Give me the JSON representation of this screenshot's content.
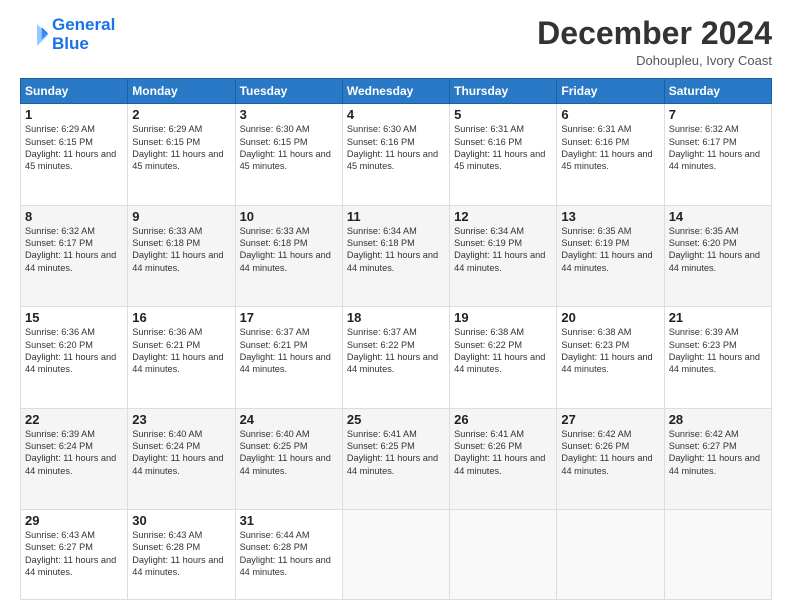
{
  "logo": {
    "line1": "General",
    "line2": "Blue"
  },
  "header": {
    "month": "December 2024",
    "location": "Dohoupleu, Ivory Coast"
  },
  "weekdays": [
    "Sunday",
    "Monday",
    "Tuesday",
    "Wednesday",
    "Thursday",
    "Friday",
    "Saturday"
  ],
  "weeks": [
    [
      {
        "day": "1",
        "rise": "6:29 AM",
        "set": "6:15 PM",
        "dh": "11 hours and 45 minutes."
      },
      {
        "day": "2",
        "rise": "6:29 AM",
        "set": "6:15 PM",
        "dh": "11 hours and 45 minutes."
      },
      {
        "day": "3",
        "rise": "6:30 AM",
        "set": "6:15 PM",
        "dh": "11 hours and 45 minutes."
      },
      {
        "day": "4",
        "rise": "6:30 AM",
        "set": "6:16 PM",
        "dh": "11 hours and 45 minutes."
      },
      {
        "day": "5",
        "rise": "6:31 AM",
        "set": "6:16 PM",
        "dh": "11 hours and 45 minutes."
      },
      {
        "day": "6",
        "rise": "6:31 AM",
        "set": "6:16 PM",
        "dh": "11 hours and 45 minutes."
      },
      {
        "day": "7",
        "rise": "6:32 AM",
        "set": "6:17 PM",
        "dh": "11 hours and 44 minutes."
      }
    ],
    [
      {
        "day": "8",
        "rise": "6:32 AM",
        "set": "6:17 PM",
        "dh": "11 hours and 44 minutes."
      },
      {
        "day": "9",
        "rise": "6:33 AM",
        "set": "6:18 PM",
        "dh": "11 hours and 44 minutes."
      },
      {
        "day": "10",
        "rise": "6:33 AM",
        "set": "6:18 PM",
        "dh": "11 hours and 44 minutes."
      },
      {
        "day": "11",
        "rise": "6:34 AM",
        "set": "6:18 PM",
        "dh": "11 hours and 44 minutes."
      },
      {
        "day": "12",
        "rise": "6:34 AM",
        "set": "6:19 PM",
        "dh": "11 hours and 44 minutes."
      },
      {
        "day": "13",
        "rise": "6:35 AM",
        "set": "6:19 PM",
        "dh": "11 hours and 44 minutes."
      },
      {
        "day": "14",
        "rise": "6:35 AM",
        "set": "6:20 PM",
        "dh": "11 hours and 44 minutes."
      }
    ],
    [
      {
        "day": "15",
        "rise": "6:36 AM",
        "set": "6:20 PM",
        "dh": "11 hours and 44 minutes."
      },
      {
        "day": "16",
        "rise": "6:36 AM",
        "set": "6:21 PM",
        "dh": "11 hours and 44 minutes."
      },
      {
        "day": "17",
        "rise": "6:37 AM",
        "set": "6:21 PM",
        "dh": "11 hours and 44 minutes."
      },
      {
        "day": "18",
        "rise": "6:37 AM",
        "set": "6:22 PM",
        "dh": "11 hours and 44 minutes."
      },
      {
        "day": "19",
        "rise": "6:38 AM",
        "set": "6:22 PM",
        "dh": "11 hours and 44 minutes."
      },
      {
        "day": "20",
        "rise": "6:38 AM",
        "set": "6:23 PM",
        "dh": "11 hours and 44 minutes."
      },
      {
        "day": "21",
        "rise": "6:39 AM",
        "set": "6:23 PM",
        "dh": "11 hours and 44 minutes."
      }
    ],
    [
      {
        "day": "22",
        "rise": "6:39 AM",
        "set": "6:24 PM",
        "dh": "11 hours and 44 minutes."
      },
      {
        "day": "23",
        "rise": "6:40 AM",
        "set": "6:24 PM",
        "dh": "11 hours and 44 minutes."
      },
      {
        "day": "24",
        "rise": "6:40 AM",
        "set": "6:25 PM",
        "dh": "11 hours and 44 minutes."
      },
      {
        "day": "25",
        "rise": "6:41 AM",
        "set": "6:25 PM",
        "dh": "11 hours and 44 minutes."
      },
      {
        "day": "26",
        "rise": "6:41 AM",
        "set": "6:26 PM",
        "dh": "11 hours and 44 minutes."
      },
      {
        "day": "27",
        "rise": "6:42 AM",
        "set": "6:26 PM",
        "dh": "11 hours and 44 minutes."
      },
      {
        "day": "28",
        "rise": "6:42 AM",
        "set": "6:27 PM",
        "dh": "11 hours and 44 minutes."
      }
    ],
    [
      {
        "day": "29",
        "rise": "6:43 AM",
        "set": "6:27 PM",
        "dh": "11 hours and 44 minutes."
      },
      {
        "day": "30",
        "rise": "6:43 AM",
        "set": "6:28 PM",
        "dh": "11 hours and 44 minutes."
      },
      {
        "day": "31",
        "rise": "6:44 AM",
        "set": "6:28 PM",
        "dh": "11 hours and 44 minutes."
      },
      null,
      null,
      null,
      null
    ]
  ]
}
